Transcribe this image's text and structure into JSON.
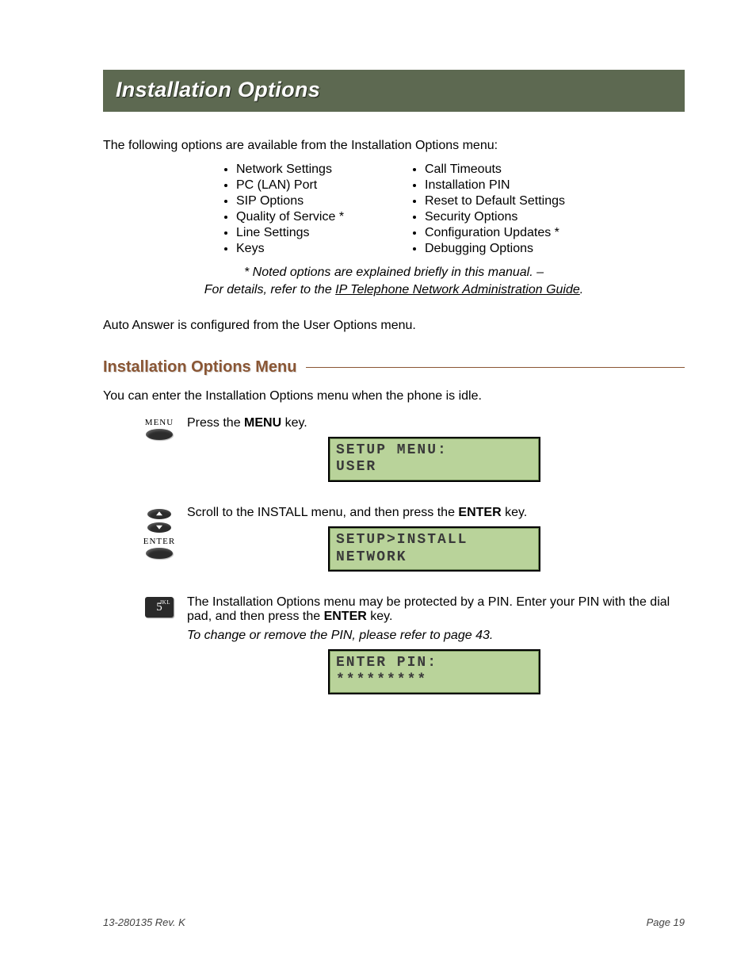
{
  "header": {
    "title": "Installation Options"
  },
  "intro": "The following options are available from the Installation Options menu:",
  "options_left": [
    "Network Settings",
    "PC (LAN) Port",
    "SIP Options",
    "Quality of Service *",
    "Line Settings",
    "Keys"
  ],
  "options_right": [
    "Call Timeouts",
    "Installation PIN",
    "Reset to Default Settings",
    "Security Options",
    "Configuration Updates *",
    "Debugging Options"
  ],
  "note_line1": "* Noted options are explained briefly in this manual. –",
  "note_line2_pre": "For details, refer to the ",
  "note_line2_link": "IP Telephone Network Administration Guide",
  "note_line2_post": ".",
  "auto_answer": "Auto Answer is configured from the User Options menu.",
  "section_heading": "Installation Options Menu",
  "section_intro": "You can enter the Installation Options menu when the phone is idle.",
  "step1": {
    "menu_label": "MENU",
    "text_pre": "Press the ",
    "text_bold": "MENU",
    "text_post": " key.",
    "lcd_l1": "SETUP MENU:",
    "lcd_l2": "USER"
  },
  "step2": {
    "enter_label": "ENTER",
    "text_pre": "Scroll to the INSTALL menu, and then press the ",
    "text_bold": "ENTER",
    "text_post": " key.",
    "lcd_l1": "SETUP>INSTALL",
    "lcd_l2": "NETWORK"
  },
  "step3": {
    "key_digit": "5",
    "key_letters": "JKL",
    "text_pre": "The Installation Options menu may be protected by a PIN. Enter your PIN with the dial pad, and then press the ",
    "text_bold": "ENTER",
    "text_post": " key.",
    "change_note": "To change or remove the PIN, please refer to page 43.",
    "lcd_l1": "ENTER PIN:",
    "lcd_l2": "*********"
  },
  "footer": {
    "left": "13-280135  Rev. K",
    "right": "Page 19"
  }
}
